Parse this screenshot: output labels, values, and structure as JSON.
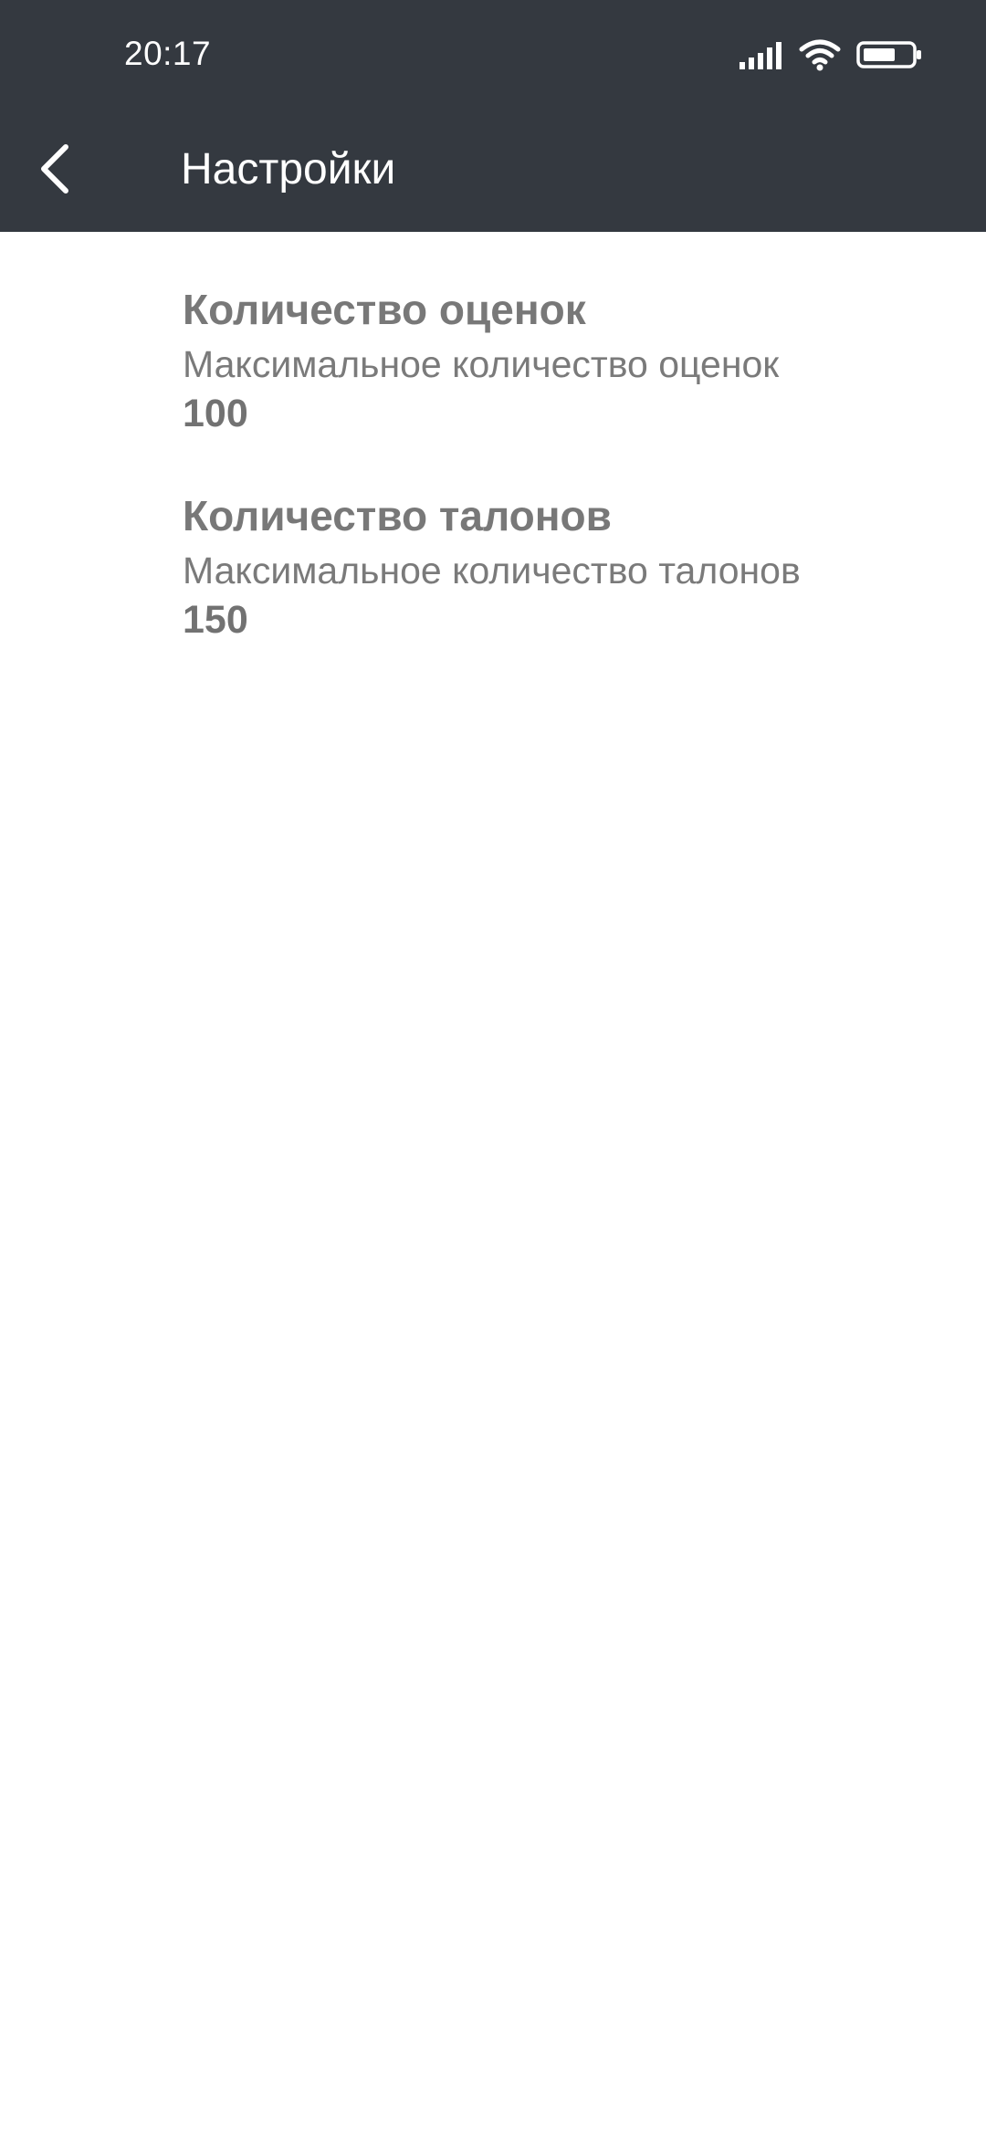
{
  "status_bar": {
    "time": "20:17",
    "icons": [
      "signal-icon",
      "wifi-icon",
      "battery-icon"
    ]
  },
  "toolbar": {
    "title": "Настройки",
    "back_icon": "chevron-left-icon"
  },
  "colors": {
    "toolbar_bg": "#343940",
    "toolbar_text": "#ffffff",
    "page_bg": "#ffffff",
    "pref_text": "#787878"
  },
  "preferences": [
    {
      "title": "Количество оценок",
      "summary": "Максимальное количество оценок",
      "value": "100"
    },
    {
      "title": "Количество талонов",
      "summary": "Максимальное количество талонов",
      "value": "150"
    }
  ]
}
